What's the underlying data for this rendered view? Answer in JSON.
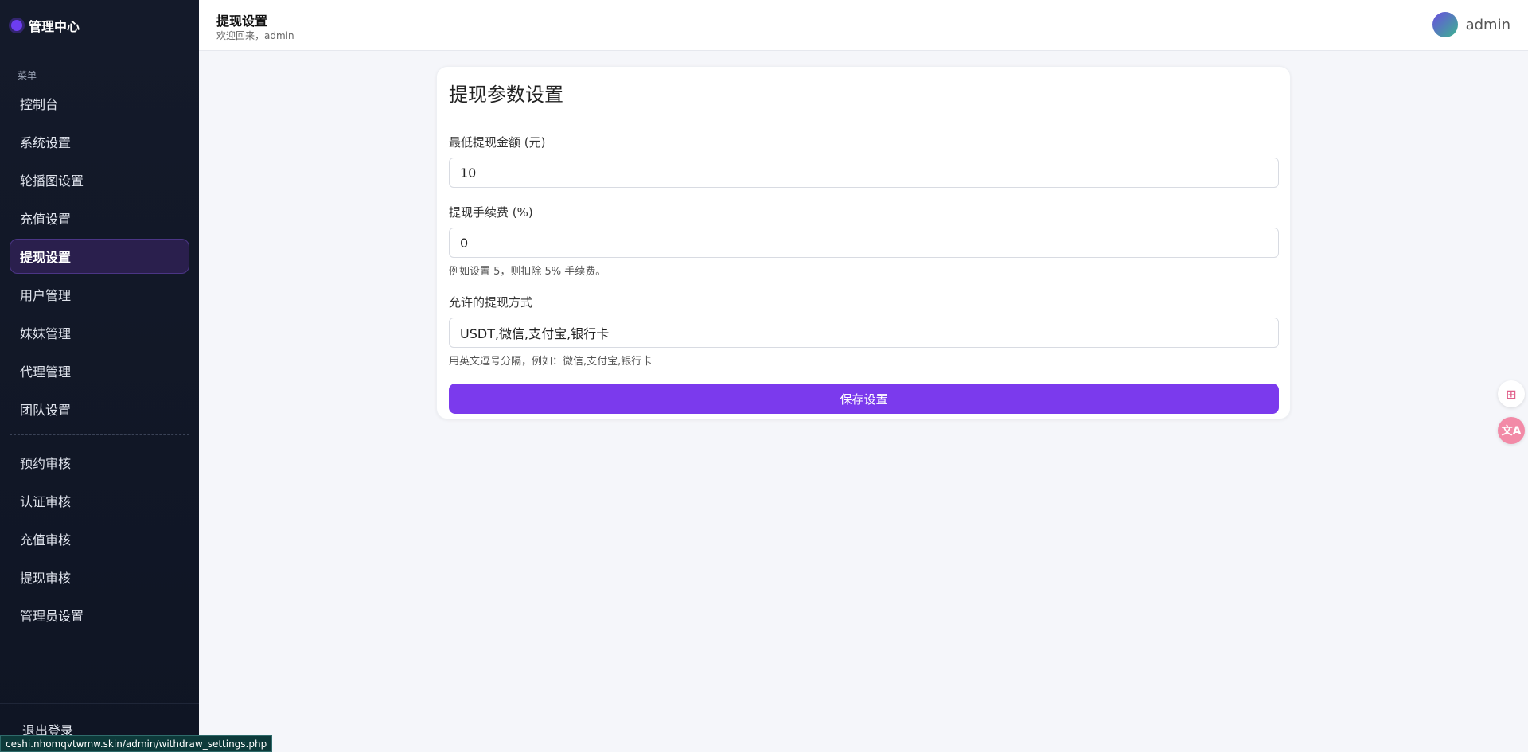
{
  "sidebar": {
    "brand": "管理中心",
    "menu_caption": "菜单",
    "group1": [
      {
        "label": "控制台",
        "active": false
      },
      {
        "label": "系统设置",
        "active": false
      },
      {
        "label": "轮播图设置",
        "active": false
      },
      {
        "label": "充值设置",
        "active": false
      },
      {
        "label": "提现设置",
        "active": true
      },
      {
        "label": "用户管理",
        "active": false
      },
      {
        "label": "妹妹管理",
        "active": false
      },
      {
        "label": "代理管理",
        "active": false
      },
      {
        "label": "团队设置",
        "active": false
      }
    ],
    "group2": [
      {
        "label": "预约审核"
      },
      {
        "label": "认证审核"
      },
      {
        "label": "充值审核"
      },
      {
        "label": "提现审核"
      },
      {
        "label": "管理员设置"
      }
    ],
    "logout": "退出登录"
  },
  "status_url": "ceshi.nhomqvtwmw.skin/admin/withdraw_settings.php",
  "header": {
    "title": "提现设置",
    "welcome": "欢迎回来，admin",
    "username": "admin"
  },
  "card": {
    "title": "提现参数设置",
    "fields": {
      "min_amount": {
        "label": "最低提现金额 (元)",
        "value": "10"
      },
      "fee": {
        "label": "提现手续费 (%)",
        "value": "0",
        "help": "例如设置 5，则扣除 5% 手续费。"
      },
      "methods": {
        "label": "允许的提现方式",
        "value": "USDT,微信,支付宝,银行卡",
        "help": "用英文逗号分隔，例如：微信,支付宝,银行卡"
      }
    },
    "save_label": "保存设置"
  },
  "float_tools": [
    {
      "icon": "apps-sparkle-icon",
      "glyph": "⊞"
    },
    {
      "icon": "translate-icon",
      "glyph": "文A"
    }
  ],
  "colors": {
    "accent": "#7b3aed",
    "sidebar_bg": "#141a2a",
    "active_bg": "#2a1f4d"
  }
}
